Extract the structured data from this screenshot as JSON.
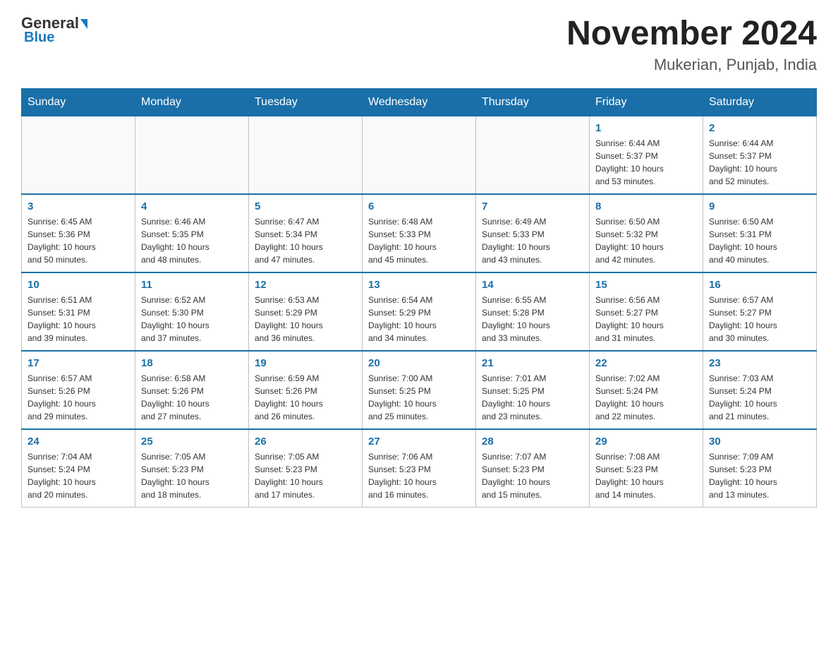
{
  "logo": {
    "general": "General",
    "blue": "Blue"
  },
  "title": "November 2024",
  "location": "Mukerian, Punjab, India",
  "days_of_week": [
    "Sunday",
    "Monday",
    "Tuesday",
    "Wednesday",
    "Thursday",
    "Friday",
    "Saturday"
  ],
  "weeks": [
    [
      {
        "day": "",
        "info": ""
      },
      {
        "day": "",
        "info": ""
      },
      {
        "day": "",
        "info": ""
      },
      {
        "day": "",
        "info": ""
      },
      {
        "day": "",
        "info": ""
      },
      {
        "day": "1",
        "info": "Sunrise: 6:44 AM\nSunset: 5:37 PM\nDaylight: 10 hours\nand 53 minutes."
      },
      {
        "day": "2",
        "info": "Sunrise: 6:44 AM\nSunset: 5:37 PM\nDaylight: 10 hours\nand 52 minutes."
      }
    ],
    [
      {
        "day": "3",
        "info": "Sunrise: 6:45 AM\nSunset: 5:36 PM\nDaylight: 10 hours\nand 50 minutes."
      },
      {
        "day": "4",
        "info": "Sunrise: 6:46 AM\nSunset: 5:35 PM\nDaylight: 10 hours\nand 48 minutes."
      },
      {
        "day": "5",
        "info": "Sunrise: 6:47 AM\nSunset: 5:34 PM\nDaylight: 10 hours\nand 47 minutes."
      },
      {
        "day": "6",
        "info": "Sunrise: 6:48 AM\nSunset: 5:33 PM\nDaylight: 10 hours\nand 45 minutes."
      },
      {
        "day": "7",
        "info": "Sunrise: 6:49 AM\nSunset: 5:33 PM\nDaylight: 10 hours\nand 43 minutes."
      },
      {
        "day": "8",
        "info": "Sunrise: 6:50 AM\nSunset: 5:32 PM\nDaylight: 10 hours\nand 42 minutes."
      },
      {
        "day": "9",
        "info": "Sunrise: 6:50 AM\nSunset: 5:31 PM\nDaylight: 10 hours\nand 40 minutes."
      }
    ],
    [
      {
        "day": "10",
        "info": "Sunrise: 6:51 AM\nSunset: 5:31 PM\nDaylight: 10 hours\nand 39 minutes."
      },
      {
        "day": "11",
        "info": "Sunrise: 6:52 AM\nSunset: 5:30 PM\nDaylight: 10 hours\nand 37 minutes."
      },
      {
        "day": "12",
        "info": "Sunrise: 6:53 AM\nSunset: 5:29 PM\nDaylight: 10 hours\nand 36 minutes."
      },
      {
        "day": "13",
        "info": "Sunrise: 6:54 AM\nSunset: 5:29 PM\nDaylight: 10 hours\nand 34 minutes."
      },
      {
        "day": "14",
        "info": "Sunrise: 6:55 AM\nSunset: 5:28 PM\nDaylight: 10 hours\nand 33 minutes."
      },
      {
        "day": "15",
        "info": "Sunrise: 6:56 AM\nSunset: 5:27 PM\nDaylight: 10 hours\nand 31 minutes."
      },
      {
        "day": "16",
        "info": "Sunrise: 6:57 AM\nSunset: 5:27 PM\nDaylight: 10 hours\nand 30 minutes."
      }
    ],
    [
      {
        "day": "17",
        "info": "Sunrise: 6:57 AM\nSunset: 5:26 PM\nDaylight: 10 hours\nand 29 minutes."
      },
      {
        "day": "18",
        "info": "Sunrise: 6:58 AM\nSunset: 5:26 PM\nDaylight: 10 hours\nand 27 minutes."
      },
      {
        "day": "19",
        "info": "Sunrise: 6:59 AM\nSunset: 5:26 PM\nDaylight: 10 hours\nand 26 minutes."
      },
      {
        "day": "20",
        "info": "Sunrise: 7:00 AM\nSunset: 5:25 PM\nDaylight: 10 hours\nand 25 minutes."
      },
      {
        "day": "21",
        "info": "Sunrise: 7:01 AM\nSunset: 5:25 PM\nDaylight: 10 hours\nand 23 minutes."
      },
      {
        "day": "22",
        "info": "Sunrise: 7:02 AM\nSunset: 5:24 PM\nDaylight: 10 hours\nand 22 minutes."
      },
      {
        "day": "23",
        "info": "Sunrise: 7:03 AM\nSunset: 5:24 PM\nDaylight: 10 hours\nand 21 minutes."
      }
    ],
    [
      {
        "day": "24",
        "info": "Sunrise: 7:04 AM\nSunset: 5:24 PM\nDaylight: 10 hours\nand 20 minutes."
      },
      {
        "day": "25",
        "info": "Sunrise: 7:05 AM\nSunset: 5:23 PM\nDaylight: 10 hours\nand 18 minutes."
      },
      {
        "day": "26",
        "info": "Sunrise: 7:05 AM\nSunset: 5:23 PM\nDaylight: 10 hours\nand 17 minutes."
      },
      {
        "day": "27",
        "info": "Sunrise: 7:06 AM\nSunset: 5:23 PM\nDaylight: 10 hours\nand 16 minutes."
      },
      {
        "day": "28",
        "info": "Sunrise: 7:07 AM\nSunset: 5:23 PM\nDaylight: 10 hours\nand 15 minutes."
      },
      {
        "day": "29",
        "info": "Sunrise: 7:08 AM\nSunset: 5:23 PM\nDaylight: 10 hours\nand 14 minutes."
      },
      {
        "day": "30",
        "info": "Sunrise: 7:09 AM\nSunset: 5:23 PM\nDaylight: 10 hours\nand 13 minutes."
      }
    ]
  ]
}
